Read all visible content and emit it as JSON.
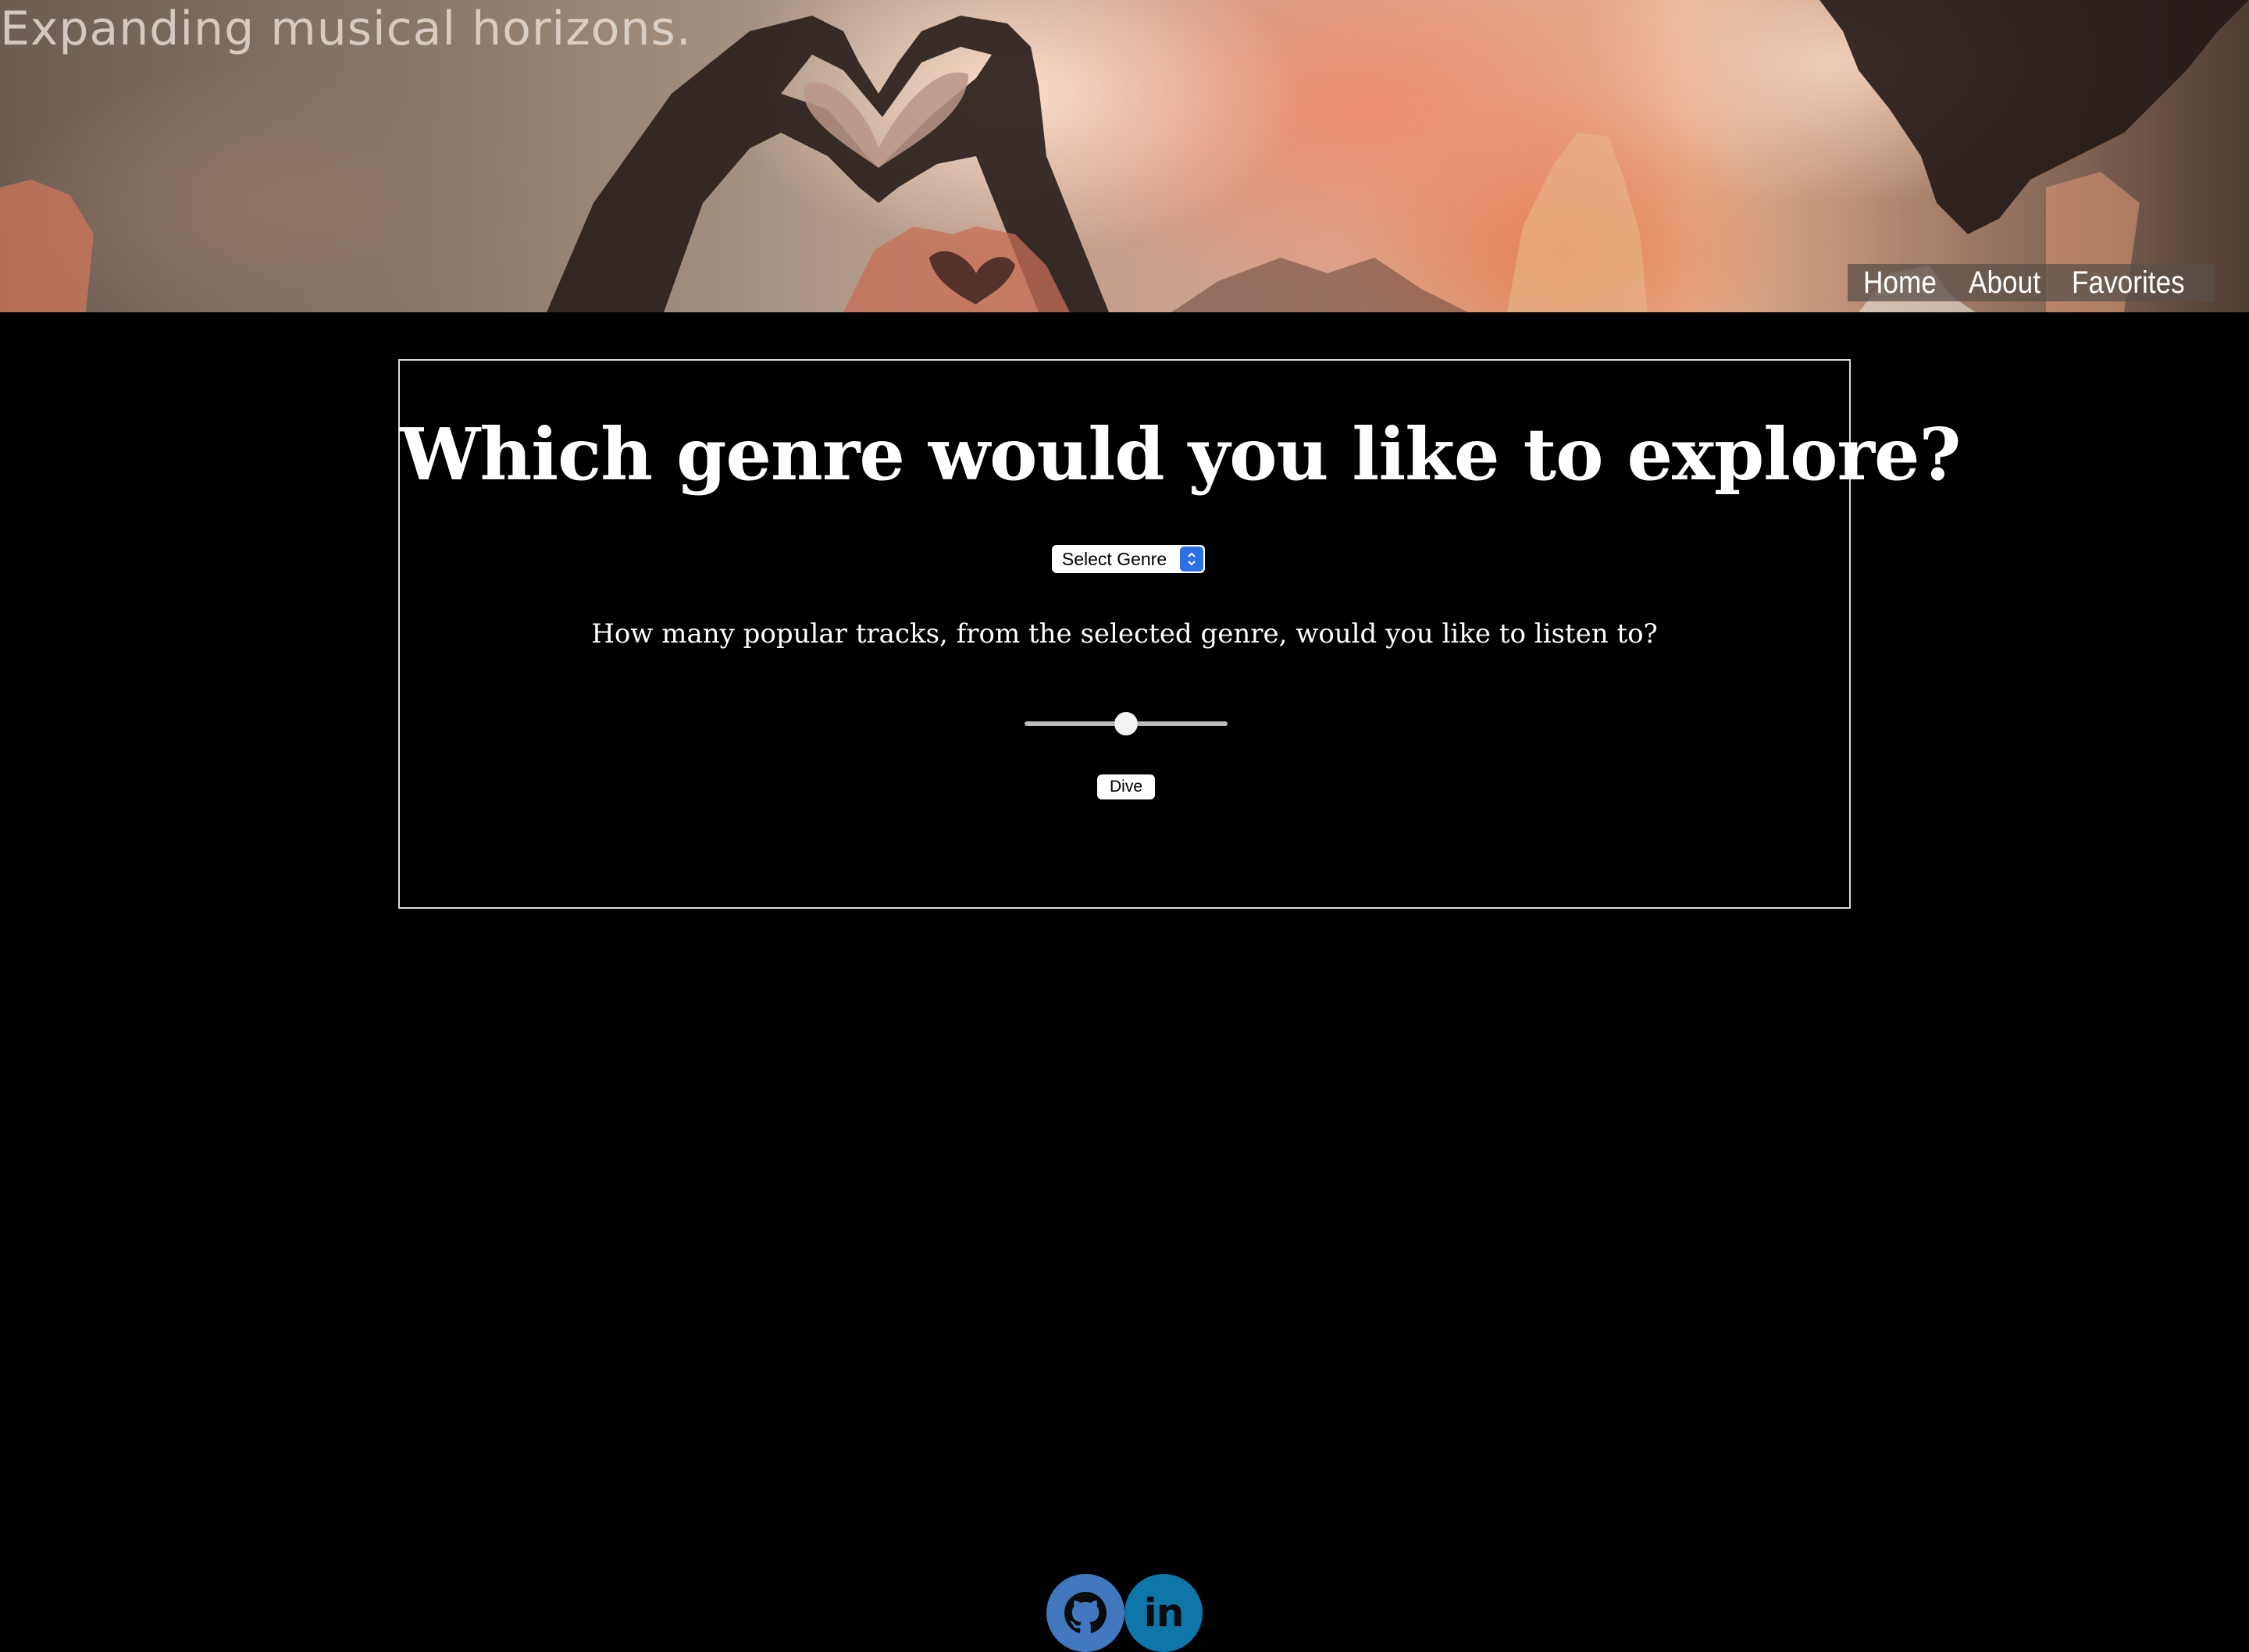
{
  "header": {
    "tagline": "Expanding musical horizons.",
    "nav": [
      {
        "label": "Home"
      },
      {
        "label": "About"
      },
      {
        "label": "Favorites"
      }
    ]
  },
  "main": {
    "heading": "Which genre would you like to explore?",
    "genre_select": {
      "selected": "Select Genre"
    },
    "question": "How many popular tracks, from the selected genre, would you like to listen to?",
    "track_slider": {
      "value_fraction": 0.5
    },
    "dive_button": "Dive"
  },
  "footer": {
    "social": [
      {
        "icon": "github-icon"
      },
      {
        "icon": "linkedin-icon",
        "text": "in"
      }
    ]
  },
  "colors": {
    "background": "#000000",
    "github_circle": "#4178c0",
    "linkedin_circle": "#0e76a8",
    "select_arrow": "#2f6fe6"
  }
}
